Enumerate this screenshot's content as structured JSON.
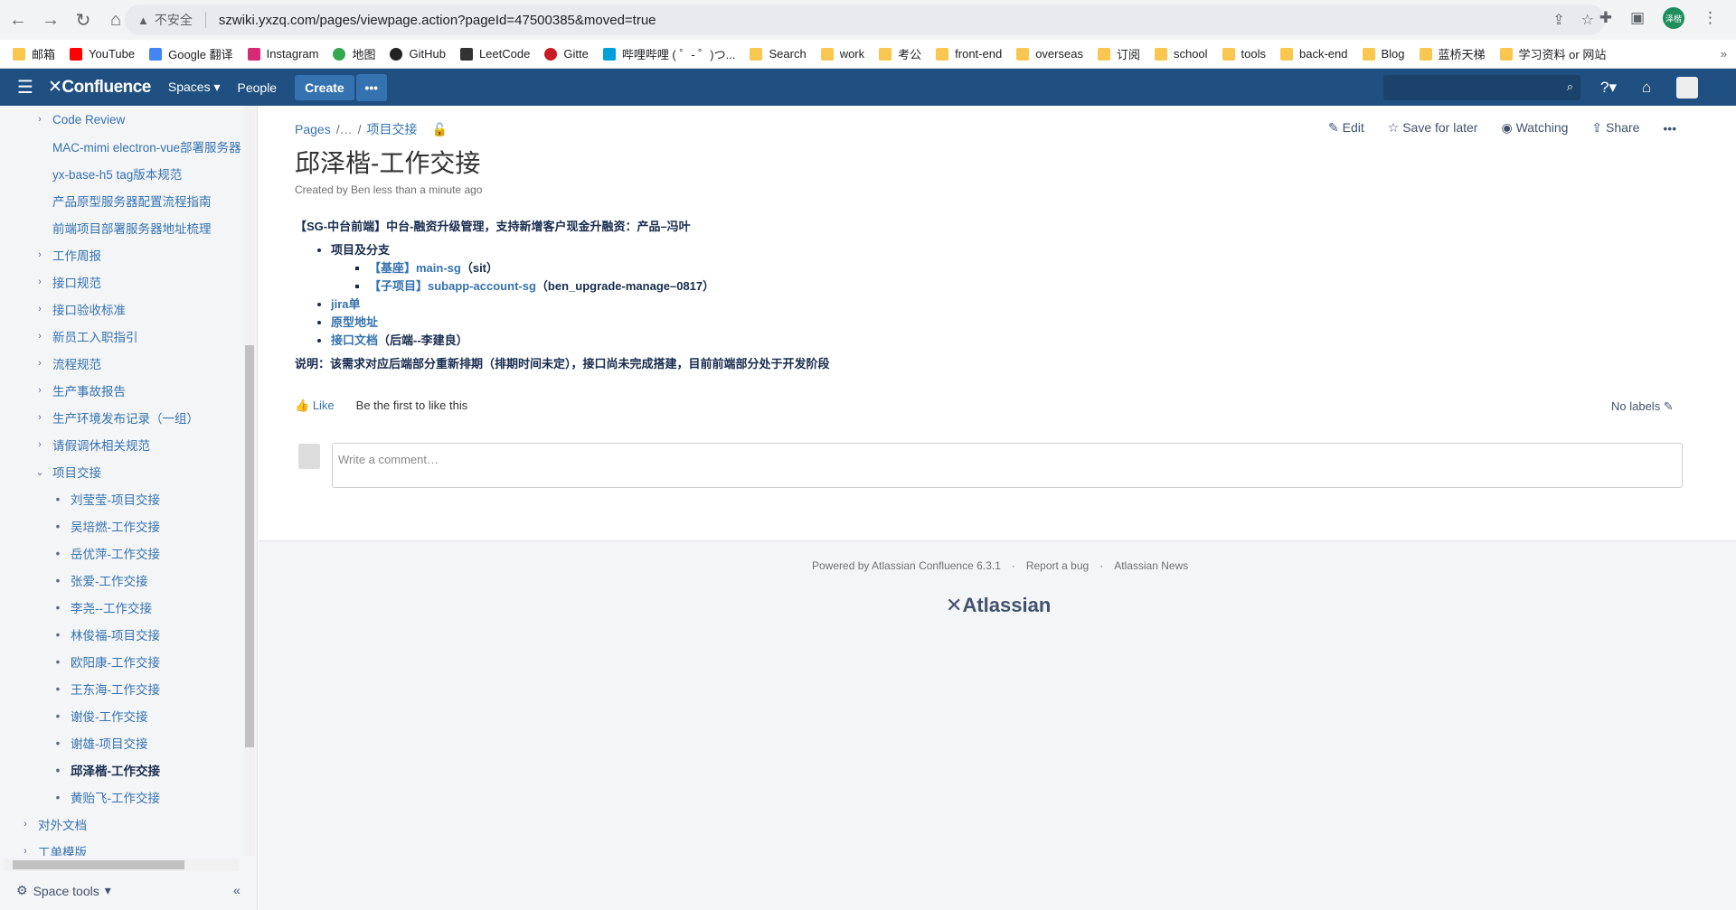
{
  "browser": {
    "insecure_label": "不安全",
    "url": "szwiki.yxzq.com/pages/viewpage.action?pageId=47500385&moved=true",
    "profile_initials": "泽楷",
    "bookmarks": [
      "邮箱",
      "YouTube",
      "Google 翻译",
      "Instagram",
      "地图",
      "GitHub",
      "LeetCode",
      "Gitte",
      "哔哩哔哩 ( ゜- ゜)つ...",
      "Search",
      "work",
      "考公",
      "front-end",
      "overseas",
      "订阅",
      "school",
      "tools",
      "back-end",
      "Blog",
      "蓝桥天梯",
      "学习资料 or 网站"
    ]
  },
  "header": {
    "logo": "Confluence",
    "spaces": "Spaces",
    "people": "People",
    "create": "Create",
    "more": "•••"
  },
  "sidebar": {
    "items": [
      {
        "label": "Code Review",
        "level": 1,
        "chev": "›"
      },
      {
        "label": "MAC-mimi electron-vue部署服务器",
        "level": 1,
        "chev": ""
      },
      {
        "label": "yx-base-h5 tag版本规范",
        "level": 1,
        "chev": ""
      },
      {
        "label": "产品原型服务器配置流程指南",
        "level": 1,
        "chev": ""
      },
      {
        "label": "前端项目部署服务器地址梳理",
        "level": 1,
        "chev": ""
      },
      {
        "label": "工作周报",
        "level": 1,
        "chev": "›"
      },
      {
        "label": "接口规范",
        "level": 1,
        "chev": "›"
      },
      {
        "label": "接口验收标准",
        "level": 1,
        "chev": "›"
      },
      {
        "label": "新员工入职指引",
        "level": 1,
        "chev": "›"
      },
      {
        "label": "流程规范",
        "level": 1,
        "chev": "›"
      },
      {
        "label": "生产事故报告",
        "level": 1,
        "chev": "›"
      },
      {
        "label": "生产环境发布记录（一组）",
        "level": 1,
        "chev": "›"
      },
      {
        "label": "请假调休相关规范",
        "level": 1,
        "chev": "›"
      },
      {
        "label": "项目交接",
        "level": 1,
        "chev": "⌄"
      },
      {
        "label": "刘莹莹-项目交接",
        "level": 2
      },
      {
        "label": "吴培燃-工作交接",
        "level": 2
      },
      {
        "label": "岳优萍-工作交接",
        "level": 2
      },
      {
        "label": "张爱-工作交接",
        "level": 2
      },
      {
        "label": "李尧--工作交接",
        "level": 2
      },
      {
        "label": "林俊福-项目交接",
        "level": 2
      },
      {
        "label": "欧阳康-工作交接",
        "level": 2
      },
      {
        "label": "王东海-工作交接",
        "level": 2
      },
      {
        "label": "谢俊-工作交接",
        "level": 2
      },
      {
        "label": "谢雄-项目交接",
        "level": 2
      },
      {
        "label": "邱泽楷-工作交接",
        "level": 2,
        "current": true
      },
      {
        "label": "黄贻飞-工作交接",
        "level": 2
      },
      {
        "label": "对外文档",
        "level": 0,
        "chev": "›"
      },
      {
        "label": "工单模版",
        "level": 0,
        "chev": "›"
      }
    ],
    "space_tools": "Space tools"
  },
  "page": {
    "breadcrumb_pages": "Pages",
    "breadcrumb_ellipsis": "/…",
    "breadcrumb_parent": "项目交接",
    "actions": {
      "edit": "Edit",
      "save": "Save for later",
      "watching": "Watching",
      "share": "Share"
    },
    "title": "邱泽楷-工作交接",
    "meta": "Created by Ben less than a minute ago",
    "intro": "【SG-中台前端】中台-融资升级管理，支持新增客户现金升融资：产品–冯叶",
    "list_header": "项目及分支",
    "sub1_link": "【基座】main-sg",
    "sub1_text": "（sit）",
    "sub2_link": "【子项目】subapp-account-sg",
    "sub2_text": "（ben_upgrade-manage–0817）",
    "jira": "jira单",
    "proto": "原型地址",
    "api_link": "接口文档",
    "api_text": "（后端--李建良）",
    "note": "说明：该需求对应后端部分重新排期（排期时间未定），接口尚未完成搭建，目前前端部分处于开发阶段",
    "like": "Like",
    "like_text": "Be the first to like this",
    "labels": "No labels",
    "comment_placeholder": "Write a comment…"
  },
  "footer": {
    "powered": "Powered by Atlassian Confluence 6.3.1",
    "report": "Report a bug",
    "news": "Atlassian News",
    "logo": "Atlassian"
  }
}
